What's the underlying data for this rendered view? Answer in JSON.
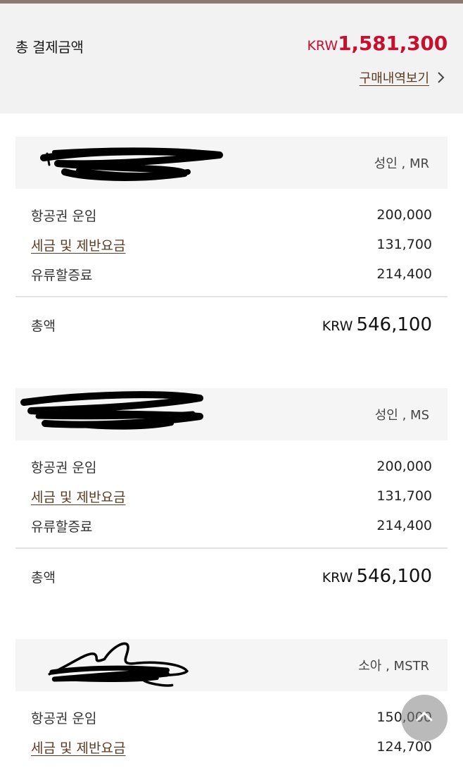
{
  "summary": {
    "title": "총 결제금액",
    "currency": "KRW",
    "amount": "1,581,300",
    "history_link": "구매내역보기"
  },
  "passengers": [
    {
      "type": "성인 , MR",
      "rows": [
        {
          "label": "항공권 운임",
          "value": "200,000"
        },
        {
          "label": "세금 및 제반요금",
          "value": "131,700"
        },
        {
          "label": "유류할증료",
          "value": "214,400"
        }
      ],
      "total_label": "총액",
      "total_currency": "KRW",
      "total_amount": "546,100"
    },
    {
      "type": "성인 , MS",
      "rows": [
        {
          "label": "항공권 운임",
          "value": "200,000"
        },
        {
          "label": "세금 및 제반요금",
          "value": "131,700"
        },
        {
          "label": "유류할증료",
          "value": "214,400"
        }
      ],
      "total_label": "총액",
      "total_currency": "KRW",
      "total_amount": "546,100"
    },
    {
      "type": "소아 , MSTR",
      "rows": [
        {
          "label": "항공권 운임",
          "value": "150,000"
        },
        {
          "label": "세금 및 제반요금",
          "value": "124,700"
        }
      ]
    }
  ],
  "colors": {
    "accent_red": "#c8102e",
    "link_brown": "#5a3a22",
    "summary_bg": "#f2f2f2"
  },
  "icons": {
    "history": "chevron-right-icon",
    "fab": "chevron-up-icon"
  }
}
